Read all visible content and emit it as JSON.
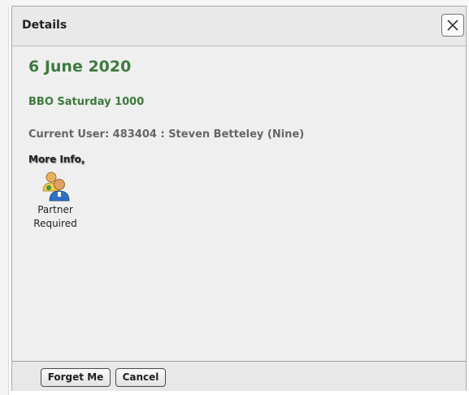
{
  "dialog": {
    "title": "Details",
    "close_icon": "close-icon"
  },
  "content": {
    "date": "6 June 2020",
    "event_name": "BBO Saturday 1000",
    "current_user": "Current User: 483404 : Steven Betteley (Nine)",
    "more_info_label": "More Info,",
    "partner": {
      "icon": "users-icon",
      "label_line1": "Partner",
      "label_line2": "Required"
    }
  },
  "footer": {
    "forget_label": "Forget Me",
    "cancel_label": "Cancel"
  },
  "colors": {
    "accent_green": "#3d7a3d",
    "muted_text": "#666666",
    "panel_bg": "#efefef"
  }
}
